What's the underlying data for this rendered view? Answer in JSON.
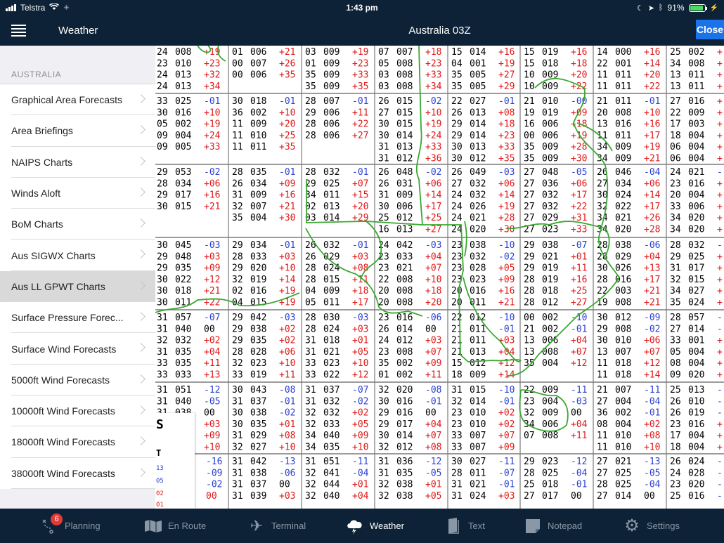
{
  "status": {
    "carrier": "Telstra",
    "time": "1:43 pm",
    "battery": "91%",
    "battery_level": 0.91
  },
  "sidebar": {
    "title": "Weather",
    "section": "AUSTRALIA",
    "items": [
      {
        "label": "Graphical Area Forecasts"
      },
      {
        "label": "Area Briefings"
      },
      {
        "label": "NAIPS Charts"
      },
      {
        "label": "Winds Aloft"
      },
      {
        "label": "BoM Charts"
      },
      {
        "label": "Aus SIGWX Charts"
      },
      {
        "label": "Aus LL GPWT Charts",
        "selected": true
      },
      {
        "label": "Surface Pressure Forec..."
      },
      {
        "label": "Surface Wind Forecasts"
      },
      {
        "label": "5000ft Wind Forecasts"
      },
      {
        "label": "10000ft Wind Forecasts"
      },
      {
        "label": "18000ft Wind Forecasts"
      },
      {
        "label": "38000ft Wind Forecasts"
      }
    ]
  },
  "main": {
    "title": "Australia 03Z",
    "close_label": "Close"
  },
  "chart": {
    "legend_big": "S",
    "legend_mid": "T",
    "legend_values": [
      "13",
      "05",
      "02",
      "01"
    ],
    "cells": [
      [
        "24 008 +19",
        "23 010 +23",
        "24 013 +32",
        "24 013 +34"
      ],
      [
        "01 006 +21",
        "00 007 +26",
        "00 006 +35"
      ],
      [
        "03 009 +19",
        "01 009 +23",
        "35 009 +33",
        "35 009 +35"
      ],
      [
        "07 007 +18",
        "05 008 +23",
        "03 008 +33",
        "03 008 +34"
      ],
      [
        "15 014 +16",
        "04 001 +19",
        "35 005 +27",
        "35 005 +29"
      ],
      [
        "15 019 +16",
        "15 018 +18",
        "10 009 +20",
        "10 009 +22"
      ],
      [
        "14 000 +16",
        "22 001 +14",
        "11 011 +20",
        "11 011 +22"
      ],
      [
        "25 002 +",
        "34 008 +",
        "13 011 +",
        "13 011 +"
      ],
      [
        "33 025 -01",
        "30 016 +10",
        "05 002 +19",
        "09 004 +24",
        "09 005 +33"
      ],
      [
        "30 018 -01",
        "36 002 +10",
        "11 009 +20",
        "11 010 +25",
        "11 011 +35"
      ],
      [
        "28 007 -01",
        "29 006 +11",
        "28 006 +22",
        "28 006 +27"
      ],
      [
        "26 015 -02",
        "27 015 +10",
        "30 015 +19",
        "30 014 +24",
        "31 013 +33",
        "31 012 +36"
      ],
      [
        "22 027 -01",
        "26 013 +08",
        "29 014 +18",
        "29 014 +23",
        "30 013 +33",
        "30 012 +35"
      ],
      [
        "21 010 -00",
        "19 019 +09",
        "16 006 +18",
        "00 006 +19",
        "35 009 +28",
        "35 009 +30"
      ],
      [
        "21 011 -01",
        "20 008 +10",
        "13 016 +16",
        "11 011 +17",
        "34 009 +19",
        "34 009 +21"
      ],
      [
        "27 016 +",
        "22 009 +",
        "17 003 +",
        "18 004 +",
        "06 004 +",
        "06 004 +"
      ],
      [
        "29 053 -02",
        "28 034 +06",
        "29 017 +16",
        "30 015 +21"
      ],
      [
        "28 035 -01",
        "26 034 +09",
        "31 009 +16",
        "32 007 +21",
        "35 004 +30"
      ],
      [
        "28 032 -01",
        "29 025 +07",
        "34 011 +15",
        "02 013 +20",
        "03 014 +29"
      ],
      [
        "26 048 -02",
        "26 031 +06",
        "31 009 +14",
        "30 006 +17",
        "25 012 +25",
        "16 013 +27"
      ],
      [
        "26 049 -03",
        "27 032 +06",
        "24 032 +14",
        "24 026 +19",
        "24 021 +28",
        "24 020 +30"
      ],
      [
        "27 048 -05",
        "27 036 +06",
        "27 032 +17",
        "27 032 +22",
        "27 029 +31",
        "27 023 +33"
      ],
      [
        "26 046 -04",
        "27 034 +06",
        "30 024 +14",
        "32 022 +17",
        "34 021 +26",
        "34 020 +28"
      ],
      [
        "24 021 -",
        "23 016 +",
        "20 004 +",
        "33 006 +",
        "34 020 +",
        "34 020 +"
      ],
      [
        "30 045 -03",
        "29 048 +03",
        "29 035 +09",
        "30 022 +12",
        "30 018 +21",
        "30 011 +22"
      ],
      [
        "29 034 -01",
        "28 033 +03",
        "29 020 +10",
        "32 019 +14",
        "02 016 +19",
        "04 015 +19"
      ],
      [
        "26 032 -01",
        "26 029 +03",
        "28 024 +08",
        "28 015 +11",
        "04 009 +18",
        "05 011 +17"
      ],
      [
        "24 042 -03",
        "23 033 +04",
        "23 021 +07",
        "22 008 +10",
        "20 008 +18",
        "20 008 +20"
      ],
      [
        "23 038 -10",
        "23 032 -02",
        "23 028 +05",
        "23 023 +09",
        "20 016 +16",
        "20 011 +21"
      ],
      [
        "29 038 -07",
        "29 021 +01",
        "29 019 +11",
        "28 019 +16",
        "28 018 +25",
        "28 012 +27"
      ],
      [
        "28 038 -06",
        "28 029 +04",
        "30 026 +13",
        "28 016 +17",
        "22 003 +21",
        "19 008 +21"
      ],
      [
        "28 032 -",
        "29 025 +",
        "31 017 +",
        "32 015 +",
        "34 027 +",
        "35 024 +"
      ],
      [
        "31 057 -07",
        "31 040 00",
        "32 032 +02",
        "31 035 +04",
        "33 035 +11",
        "33 033 +13"
      ],
      [
        "29 042 -03",
        "29 038 +02",
        "29 035 +02",
        "28 028 +06",
        "32 023 +10",
        "33 019 +11"
      ],
      [
        "28 030 -03",
        "28 024 +03",
        "31 018 +01",
        "31 021 +05",
        "33 023 +10",
        "33 022 +12"
      ],
      [
        "23 016 -06",
        "26 014 00",
        "24 012 +03",
        "23 008 +07",
        "35 002 +09",
        "01 002 +11"
      ],
      [
        "22 012 -10",
        "21 011 -01",
        "21 011 +03",
        "21 013 +04",
        "15 012 +12",
        "18 009 +14"
      ],
      [
        "00 002 -10",
        "21 002 -01",
        "13 006 +04",
        "13 008 +07",
        "35 004 +12"
      ],
      [
        "30 012 -09",
        "29 008 -02",
        "30 010 +06",
        "13 007 +07",
        "11 018 +12",
        "11 018 +14"
      ],
      [
        "28 057 -",
        "27 014 -",
        "33 001 +",
        "05 004 +",
        "08 004 +",
        "09 020 +"
      ],
      [
        "31 051 -12",
        "31 040 -05",
        "31 038 00",
        "31 033 +03",
        "31 033 +09",
        "31 035 +10"
      ],
      [
        "30 043 -08",
        "31 037 -01",
        "30 038 -02",
        "30 035 +01",
        "31 029 +08",
        "32 027 +10"
      ],
      [
        "31 037 -07",
        "31 032 -02",
        "32 032 +02",
        "32 033 +05",
        "34 040 +09",
        "34 035 +10"
      ],
      [
        "32 020 -08",
        "30 016 -01",
        "29 016 00",
        "29 017 +04",
        "30 014 +07",
        "32 012 +08"
      ],
      [
        "31 015 -10",
        "32 014 -01",
        "23 010 +02",
        "23 010 +02",
        "33 007 +07",
        "33 007 +09"
      ],
      [
        "22 009 -11",
        "23 004 -03",
        "32 009 00",
        "34 006 +04",
        "07 008 +11"
      ],
      [
        "21 007 -11",
        "27 004 -04",
        "36 002 -01",
        "08 004 +02",
        "11 010 +08",
        "11 010 +10"
      ],
      [
        "25 013 -",
        "26 010 -",
        "26 019 -",
        "23 016 +",
        "17 004 +",
        "18 004 +"
      ],
      [
        "30 -16",
        "31 -09",
        "31 -02",
        "31 00"
      ],
      [
        "31 042 -13",
        "31 038 -06",
        "31 037 00",
        "31 039 +03"
      ],
      [
        "31 051 -11",
        "32 041 -04",
        "32 044 +01",
        "32 040 +04"
      ],
      [
        "31 036 -12",
        "31 035 -05",
        "32 038 +01",
        "32 038 +05"
      ],
      [
        "30 027 -11",
        "28 011 -07",
        "31 021 -01",
        "31 024 +03"
      ],
      [
        "29 023 -12",
        "28 025 -04",
        "25 018 -01",
        "27 017 00"
      ],
      [
        "27 021 -13",
        "27 025 -05",
        "28 025 -04",
        "27 014 00"
      ],
      [
        "26 024 -",
        "24 028 -",
        "23 020 -",
        "25 016 -"
      ]
    ]
  }
}
